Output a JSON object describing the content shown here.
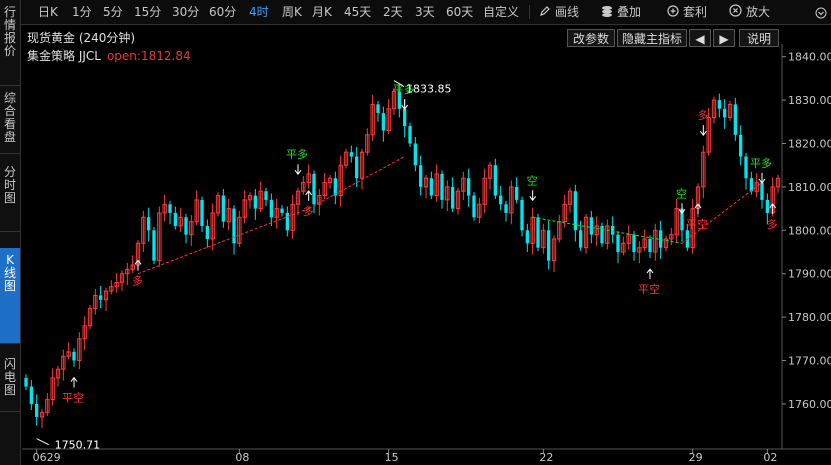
{
  "sidebar": {
    "tabs": [
      {
        "label": "行情报价",
        "active": false
      },
      {
        "label": "综合看盘",
        "active": false
      },
      {
        "label": "分时图",
        "active": false
      },
      {
        "label": "K线图",
        "active": true
      },
      {
        "label": "闪电图",
        "active": false
      }
    ]
  },
  "toolbar": {
    "periods": [
      "日K",
      "1分",
      "5分",
      "15分",
      "30分",
      "60分",
      "4时",
      "周K",
      "月K",
      "45天",
      "2天",
      "3天",
      "60天",
      "自定义"
    ],
    "active_period": "4时",
    "draw_label": "画线",
    "overlay_label": "叠加",
    "arbitrage_label": "套利",
    "zoom_in_label": "放大"
  },
  "info": {
    "title": "现货黄金 (240分钟)",
    "strategy_name": "集金策略 JJCL",
    "open_text": "open:1812.84",
    "btn_params": "改参数",
    "btn_hide": "隐藏主指标",
    "btn_left": "◀",
    "btn_right": "▶",
    "btn_help": "说明"
  },
  "colors": {
    "up": "#ff3b3b",
    "down": "#00e5ee",
    "signal_green": "#22dd22",
    "signal_red": "#ff3030",
    "axis": "#c8c8c8",
    "grid": "#2a2a2a"
  },
  "chart_data": {
    "type": "candlestick",
    "y_ticks": [
      "1840.00",
      "1830.00",
      "1820.00",
      "1810.00",
      "1800.00",
      "1790.00",
      "1780.00",
      "1770.00",
      "1760.00"
    ],
    "ylim": [
      1751,
      1842
    ],
    "x_ticks": [
      {
        "i": 2,
        "label": "0629"
      },
      {
        "i": 40,
        "label": "08"
      },
      {
        "i": 68,
        "label": "15"
      },
      {
        "i": 97,
        "label": "22"
      },
      {
        "i": 125,
        "label": "29"
      },
      {
        "i": 139,
        "label": "02"
      }
    ],
    "high_label": "1833.85",
    "low_label": "1750.71",
    "closes": [
      1764,
      1760,
      1757,
      1758,
      1761,
      1766,
      1768,
      1771,
      1772,
      1770,
      1775,
      1778,
      1782,
      1785,
      1784,
      1786,
      1787,
      1788,
      1790,
      1791,
      1792,
      1797,
      1803,
      1800,
      1793,
      1804,
      1806,
      1804,
      1801,
      1803,
      1799,
      1802,
      1807,
      1801,
      1798,
      1804,
      1808,
      1802,
      1805,
      1797,
      1803,
      1807,
      1808,
      1805,
      1809,
      1807,
      1803,
      1805,
      1804,
      1800,
      1806,
      1809,
      1811,
      1813,
      1806,
      1808,
      1811,
      1812,
      1808,
      1815,
      1818,
      1817,
      1812,
      1818,
      1822,
      1829,
      1827,
      1823,
      1828,
      1832,
      1828,
      1824,
      1820,
      1815,
      1810,
      1812,
      1808,
      1813,
      1807,
      1810,
      1805,
      1809,
      1812,
      1808,
      1803,
      1806,
      1812,
      1815,
      1808,
      1806,
      1804,
      1810,
      1807,
      1800,
      1797,
      1803,
      1796,
      1800,
      1793,
      1798,
      1802,
      1806,
      1809,
      1800,
      1796,
      1803,
      1799,
      1801,
      1797,
      1801,
      1799,
      1795,
      1797,
      1799,
      1795,
      1796,
      1798,
      1795,
      1800,
      1796,
      1798,
      1799,
      1805,
      1800,
      1796,
      1805,
      1810,
      1818,
      1826,
      1830,
      1828,
      1826,
      1829,
      1822,
      1817,
      1812,
      1809,
      1811,
      1807,
      1804,
      1810,
      1812
    ],
    "signals": [
      {
        "i": 9,
        "label": "平空",
        "color": "red",
        "pos": "below"
      },
      {
        "i": 21,
        "label": "多",
        "color": "red",
        "pos": "below"
      },
      {
        "i": 51,
        "label": "平多",
        "color": "green",
        "pos": "above"
      },
      {
        "i": 53,
        "label": "多",
        "color": "red",
        "pos": "below"
      },
      {
        "i": 71,
        "label": "平多",
        "color": "green",
        "pos": "above"
      },
      {
        "i": 95,
        "label": "空",
        "color": "green",
        "pos": "above"
      },
      {
        "i": 117,
        "label": "平空",
        "color": "red",
        "pos": "below"
      },
      {
        "i": 123,
        "label": "空",
        "color": "green",
        "pos": "above"
      },
      {
        "i": 126,
        "label": "平空",
        "color": "red",
        "pos": "below"
      },
      {
        "i": 127,
        "label": "多",
        "color": "red",
        "pos": "above"
      },
      {
        "i": 138,
        "label": "平多",
        "color": "green",
        "pos": "above"
      },
      {
        "i": 140,
        "label": "多",
        "color": "red",
        "pos": "below"
      }
    ],
    "trend_lines": [
      {
        "from": [
          21,
          1790
        ],
        "to": [
          53,
          1805
        ],
        "color": "red"
      },
      {
        "from": [
          53,
          1805
        ],
        "to": [
          71,
          1817
        ],
        "color": "red"
      },
      {
        "from": [
          95,
          1803
        ],
        "to": [
          123,
          1797
        ],
        "color": "green"
      },
      {
        "from": [
          123,
          1797
        ],
        "to": [
          138,
          1811
        ],
        "color": "red"
      }
    ]
  }
}
